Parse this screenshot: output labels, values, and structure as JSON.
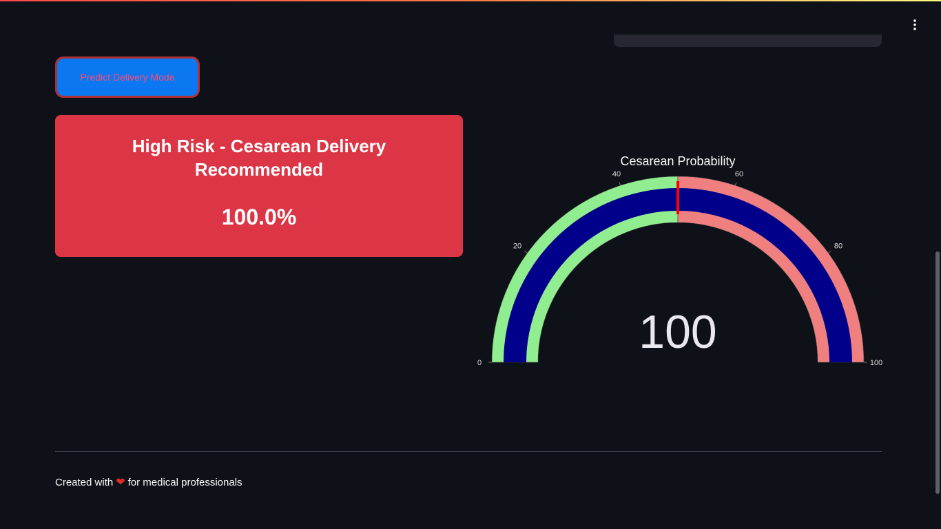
{
  "header": {
    "menu_icon": "vertical-ellipsis-icon"
  },
  "action": {
    "predict_label": "Predict Delivery Mode"
  },
  "result": {
    "title_line1": "High Risk - Cesarean Delivery",
    "title_line2": "Recommended",
    "percentage": "100.0%",
    "card_color": "#dc3545"
  },
  "gauge": {
    "title": "Cesarean Probability",
    "value": 100,
    "value_text": "100",
    "range": [
      0,
      100
    ],
    "ticks": [
      "0",
      "20",
      "40",
      "60",
      "80",
      "100"
    ],
    "threshold": 50,
    "steps": [
      {
        "range": [
          0,
          50
        ],
        "color": "#90ee90"
      },
      {
        "range": [
          50,
          100
        ],
        "color": "#f08080"
      }
    ],
    "bar_color": "#00008b",
    "threshold_color": "#ff0000"
  },
  "footer": {
    "text_before": "Created with",
    "heart_icon": "heart-icon",
    "text_after": "for medical professionals"
  }
}
